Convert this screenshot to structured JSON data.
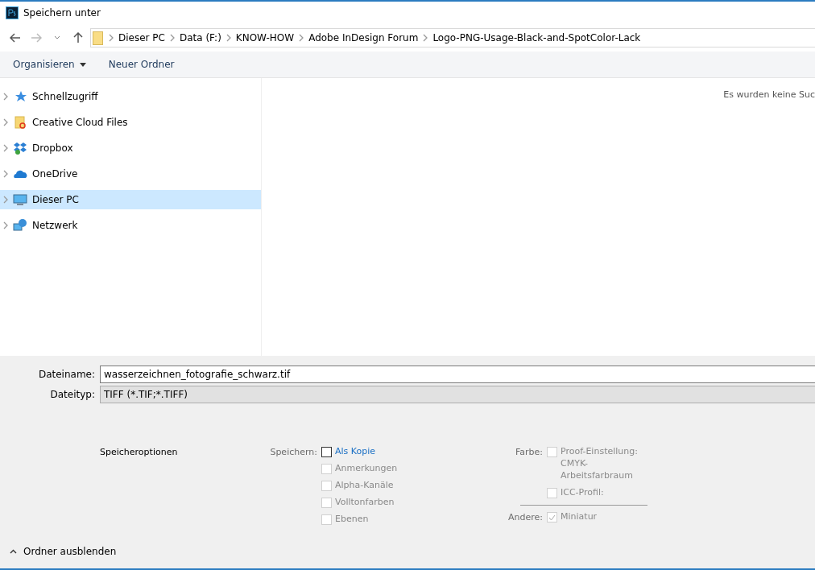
{
  "window": {
    "title": "Speichern unter"
  },
  "breadcrumb": [
    "Dieser PC",
    "Data (F:)",
    "KNOW-HOW",
    "Adobe InDesign Forum",
    "Logo-PNG-Usage-Black-and-SpotColor-Lack"
  ],
  "toolbar": {
    "organize": "Organisieren",
    "new_folder": "Neuer Ordner"
  },
  "sidebar": {
    "items": [
      {
        "label": "Schnellzugriff",
        "kind": "star",
        "selected": false
      },
      {
        "label": "Creative Cloud Files",
        "kind": "cloudfolder",
        "selected": false
      },
      {
        "label": "Dropbox",
        "kind": "dropbox",
        "selected": false
      },
      {
        "label": "OneDrive",
        "kind": "cloud",
        "selected": false
      },
      {
        "label": "Dieser PC",
        "kind": "monitor",
        "selected": true
      },
      {
        "label": "Netzwerk",
        "kind": "network",
        "selected": false
      }
    ]
  },
  "content": {
    "message": "Es wurden keine Suc"
  },
  "filename": {
    "label": "Dateiname:",
    "value": "wasserzeichnen_fotografie_schwarz.tif"
  },
  "filetype": {
    "label": "Dateityp:",
    "value": "TIFF (*.TIF;*.TIFF)"
  },
  "options": {
    "title": "Speicheroptionen",
    "columns": [
      [
        {
          "label": "Speichern:",
          "items": [
            {
              "label": "Als Kopie",
              "checked": false,
              "disabled": false
            },
            {
              "label": "Anmerkungen",
              "checked": false,
              "disabled": true
            },
            {
              "label": "Alpha-Kanäle",
              "checked": false,
              "disabled": true
            },
            {
              "label": "Volltonfarben",
              "checked": false,
              "disabled": true
            },
            {
              "label": "Ebenen",
              "checked": false,
              "disabled": true
            }
          ]
        }
      ],
      [
        {
          "label": "Farbe:",
          "items": [
            {
              "label": "Proof-Einstellung: CMYK-Arbeitsfarbraum",
              "checked": false,
              "disabled": true
            },
            {
              "label": "ICC-Profil:",
              "checked": false,
              "disabled": true
            }
          ]
        },
        {
          "label": "Andere:",
          "items": [
            {
              "label": "Miniatur",
              "checked": true,
              "disabled": true
            }
          ]
        }
      ]
    ]
  },
  "footer": {
    "toggle": "Ordner ausblenden"
  }
}
